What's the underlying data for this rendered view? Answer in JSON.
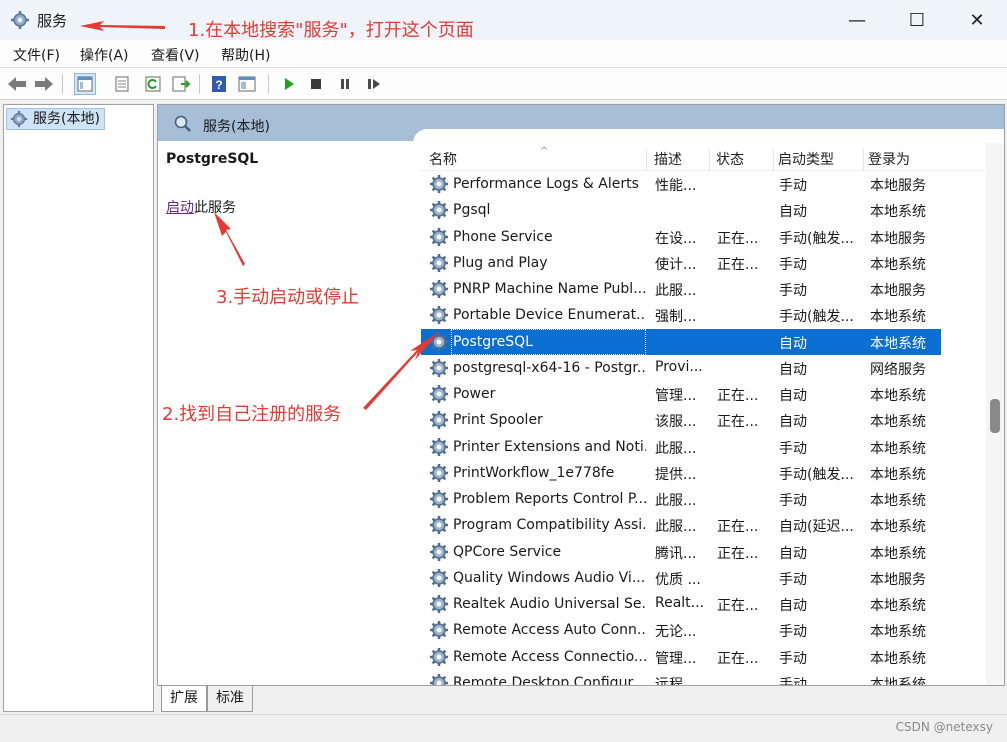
{
  "window": {
    "title": "服务",
    "minimize": "—",
    "maximize": "☐",
    "close": "✕"
  },
  "menu": [
    "文件(F)",
    "操作(A)",
    "查看(V)",
    "帮助(H)"
  ],
  "toolbar_icons": [
    "back-icon",
    "forward-icon",
    "console-tree-icon",
    "properties-icon",
    "refresh-icon",
    "export-list-icon",
    "help-icon",
    "view-icon",
    "start-service-icon",
    "stop-service-icon",
    "pause-service-icon",
    "restart-service-icon"
  ],
  "tree": {
    "item": "服务(本地)"
  },
  "main_header": {
    "title": "服务(本地)"
  },
  "description_pane": {
    "service_name": "PostgreSQL",
    "start_link": "启动",
    "start_suffix": "此服务"
  },
  "list": {
    "columns": [
      "名称",
      "描述",
      "状态",
      "启动类型",
      "登录为"
    ],
    "rows": [
      {
        "name": "Performance Logs & Alerts",
        "desc": "性能...",
        "status": "",
        "start": "手动",
        "logon": "本地服务"
      },
      {
        "name": "Pgsql",
        "desc": "",
        "status": "",
        "start": "自动",
        "logon": "本地系统"
      },
      {
        "name": "Phone Service",
        "desc": "在设...",
        "status": "正在...",
        "start": "手动(触发...",
        "logon": "本地服务"
      },
      {
        "name": "Plug and Play",
        "desc": "使计...",
        "status": "正在...",
        "start": "手动",
        "logon": "本地系统"
      },
      {
        "name": "PNRP Machine Name Publ...",
        "desc": "此服...",
        "status": "",
        "start": "手动",
        "logon": "本地服务"
      },
      {
        "name": "Portable Device Enumerat...",
        "desc": "强制...",
        "status": "",
        "start": "手动(触发...",
        "logon": "本地系统"
      },
      {
        "name": "PostgreSQL",
        "desc": "",
        "status": "",
        "start": "自动",
        "logon": "本地系统"
      },
      {
        "name": "postgresql-x64-16 - Postgr...",
        "desc": "Provi...",
        "status": "",
        "start": "自动",
        "logon": "网络服务"
      },
      {
        "name": "Power",
        "desc": "管理...",
        "status": "正在...",
        "start": "自动",
        "logon": "本地系统"
      },
      {
        "name": "Print Spooler",
        "desc": "该服...",
        "status": "正在...",
        "start": "自动",
        "logon": "本地系统"
      },
      {
        "name": "Printer Extensions and Noti...",
        "desc": "此服...",
        "status": "",
        "start": "手动",
        "logon": "本地系统"
      },
      {
        "name": "PrintWorkflow_1e778fe",
        "desc": "提供...",
        "status": "",
        "start": "手动(触发...",
        "logon": "本地系统"
      },
      {
        "name": "Problem Reports Control P...",
        "desc": "此服...",
        "status": "",
        "start": "手动",
        "logon": "本地系统"
      },
      {
        "name": "Program Compatibility Assi...",
        "desc": "此服...",
        "status": "正在...",
        "start": "自动(延迟...",
        "logon": "本地系统"
      },
      {
        "name": "QPCore Service",
        "desc": "腾讯...",
        "status": "正在...",
        "start": "自动",
        "logon": "本地系统"
      },
      {
        "name": "Quality Windows Audio Vi...",
        "desc": "优质 ...",
        "status": "",
        "start": "手动",
        "logon": "本地服务"
      },
      {
        "name": "Realtek Audio Universal Se...",
        "desc": "Realt...",
        "status": "正在...",
        "start": "自动",
        "logon": "本地系统"
      },
      {
        "name": "Remote Access Auto Conn...",
        "desc": "无论...",
        "status": "",
        "start": "手动",
        "logon": "本地系统"
      },
      {
        "name": "Remote Access Connectio...",
        "desc": "管理...",
        "status": "正在...",
        "start": "手动",
        "logon": "本地系统"
      },
      {
        "name": "Remote Desktop Configur...",
        "desc": "远程...",
        "status": "",
        "start": "手动",
        "logon": "本地系统"
      }
    ]
  },
  "bottom_tabs": [
    "扩展",
    "标准"
  ],
  "annotations": {
    "a1": "1.在本地搜索\"服务\"，打开这个页面",
    "a2": "2.找到自己注册的服务",
    "a3": "3.手动启动或停止"
  },
  "watermark": "CSDN @netexsy",
  "colors": {
    "accent_red": "#e53a33",
    "selection": "#0a6fd0",
    "header_blue": "#a7bed7"
  }
}
